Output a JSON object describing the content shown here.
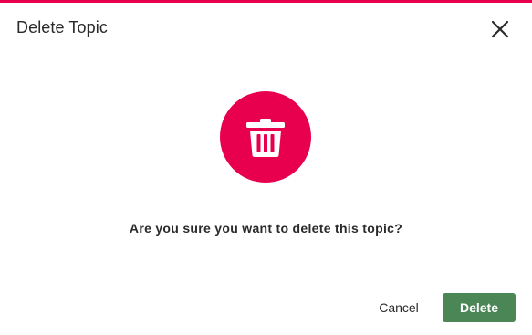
{
  "dialog": {
    "title": "Delete Topic",
    "close_icon": "close-icon",
    "hero_icon": "trash-icon",
    "message": "Are you sure you want to delete this topic?",
    "cancel_label": "Cancel",
    "confirm_label": "Delete"
  },
  "colors": {
    "accent": "#e8004e",
    "confirm_button": "#4b8657",
    "text": "#2a2a2a",
    "background": "#ffffff"
  }
}
